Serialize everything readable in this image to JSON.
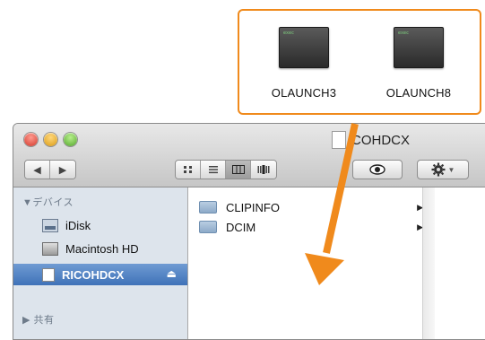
{
  "callout": {
    "files": [
      {
        "name": "OLAUNCH3",
        "icon": "terminal-executable-icon"
      },
      {
        "name": "OLAUNCH8",
        "icon": "terminal-executable-icon"
      }
    ],
    "border_color": "#f08a1c"
  },
  "window": {
    "title": "COHDCX",
    "toolbar": {
      "back": "◀",
      "forward": "▶",
      "views": [
        "icon-view",
        "list-view",
        "column-view",
        "coverflow-view"
      ],
      "active_view": "column-view",
      "eye": "quick-look",
      "action": "gear-menu"
    },
    "sidebar": {
      "devices_header": "▼デバイス",
      "items": [
        {
          "label": "iDisk",
          "icon": "idisk-icon"
        },
        {
          "label": "Macintosh HD",
          "icon": "hard-drive-icon"
        },
        {
          "label": "RICOHDCX",
          "icon": "sd-card-icon",
          "selected": true
        }
      ],
      "eject": "⏏",
      "shared_header": "▶ 共有"
    },
    "column": {
      "items": [
        {
          "label": "CLIPINFO",
          "chevron": "▶"
        },
        {
          "label": "DCIM",
          "chevron": "▶"
        }
      ]
    }
  },
  "arrow_color": "#f08a1c"
}
